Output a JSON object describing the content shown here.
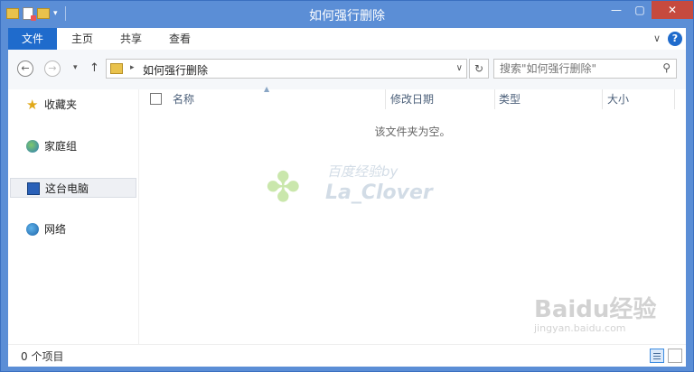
{
  "window": {
    "title": "如何强行删除"
  },
  "window_controls": {
    "minimize": "—",
    "maximize": "▢",
    "close": "✕"
  },
  "ribbon": {
    "tabs": [
      {
        "label": "文件",
        "active": true
      },
      {
        "label": "主页"
      },
      {
        "label": "共享"
      },
      {
        "label": "查看"
      }
    ],
    "help": "?"
  },
  "address": {
    "path": "如何强行删除"
  },
  "search": {
    "placeholder": "搜索\"如何强行删除\""
  },
  "nav": {
    "items": [
      {
        "label": "收藏夹",
        "icon": "star-icon"
      },
      {
        "label": "家庭组",
        "icon": "homegroup-icon"
      },
      {
        "label": "这台电脑",
        "icon": "computer-icon",
        "selected": true
      },
      {
        "label": "网络",
        "icon": "network-icon"
      }
    ]
  },
  "columns": [
    {
      "label": "名称"
    },
    {
      "label": "修改日期"
    },
    {
      "label": "类型"
    },
    {
      "label": "大小"
    }
  ],
  "empty_message": "该文件夹为空。",
  "status": {
    "count": "0 个项目"
  },
  "watermarks": {
    "line1": "百度经验by",
    "line2": "La_Clover",
    "baidu_logo": "Baidu经验",
    "baidu_url": "jingyan.baidu.com"
  },
  "colors": {
    "accent": "#1f6bcc",
    "frame": "#5b8ed6",
    "close": "#c64a3e"
  }
}
